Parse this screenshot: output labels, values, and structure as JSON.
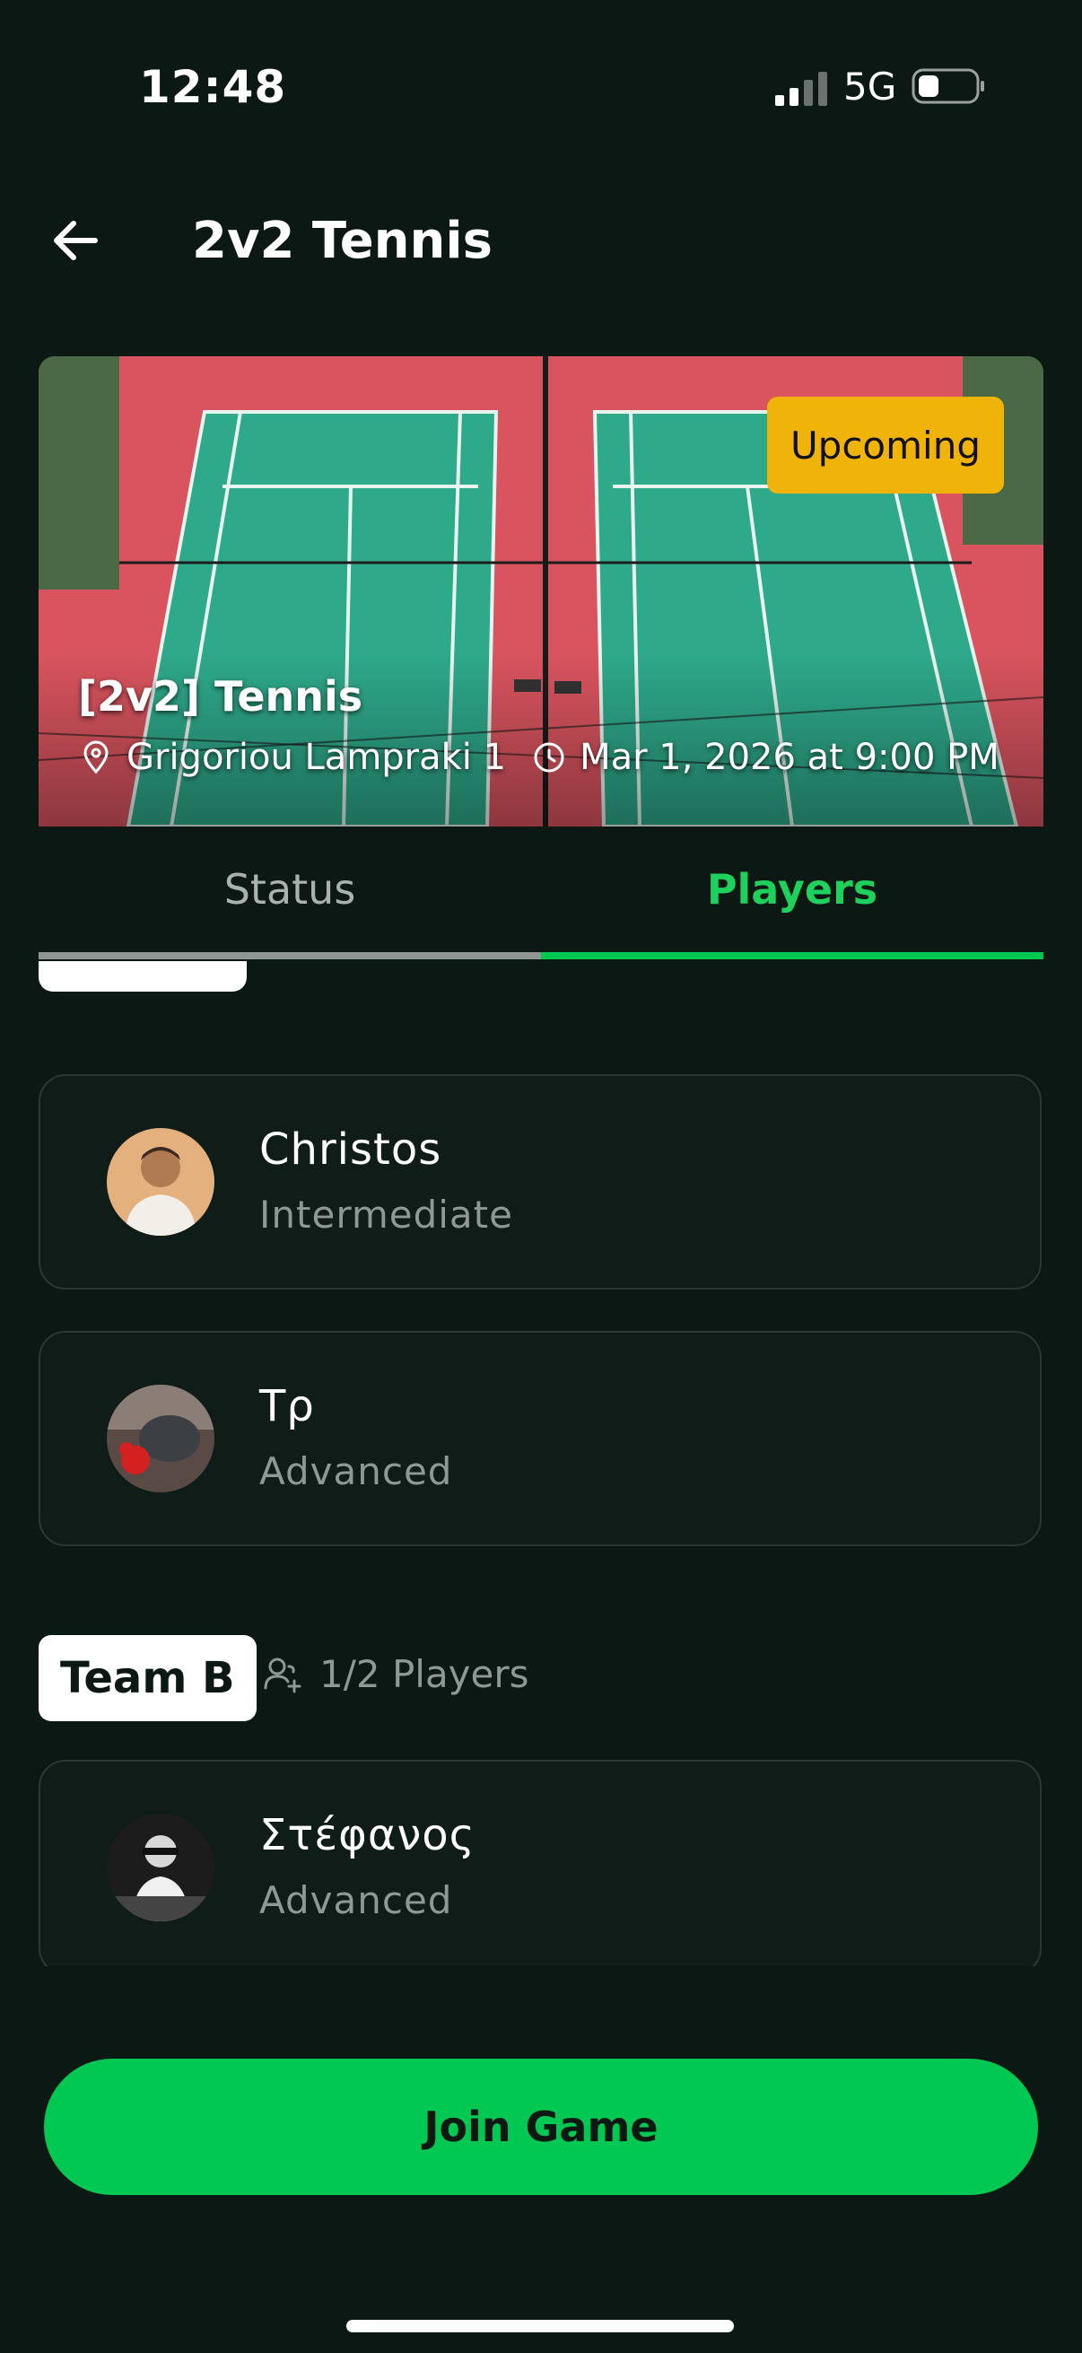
{
  "status_bar": {
    "time": "12:48",
    "network": "5G"
  },
  "header": {
    "title": "2v2 Tennis",
    "back_icon": "arrow-left-icon"
  },
  "hero": {
    "badge": "Upcoming",
    "game_title": "[2v2] Tennis",
    "location": "Grigoriou Lampraki 1",
    "datetime": "Mar 1, 2026 at 9:00 PM"
  },
  "tabs": [
    {
      "label": "Status"
    },
    {
      "label": "Players"
    }
  ],
  "active_tab": "Players",
  "team_a": {
    "players": [
      {
        "name": "Christos",
        "level": "Intermediate"
      },
      {
        "name": "Τρ",
        "level": "Advanced"
      }
    ]
  },
  "team_b": {
    "label": "Team B",
    "count": "1/2 Players",
    "players": [
      {
        "name": "Στέφανος",
        "level": "Advanced"
      }
    ]
  },
  "join_button": {
    "label": "Join Game"
  },
  "colors": {
    "background": "#0b1814",
    "accent": "#00c853",
    "badge": "#f0b30a",
    "court": "#dc5a64",
    "court_green": "#2ea98a"
  }
}
